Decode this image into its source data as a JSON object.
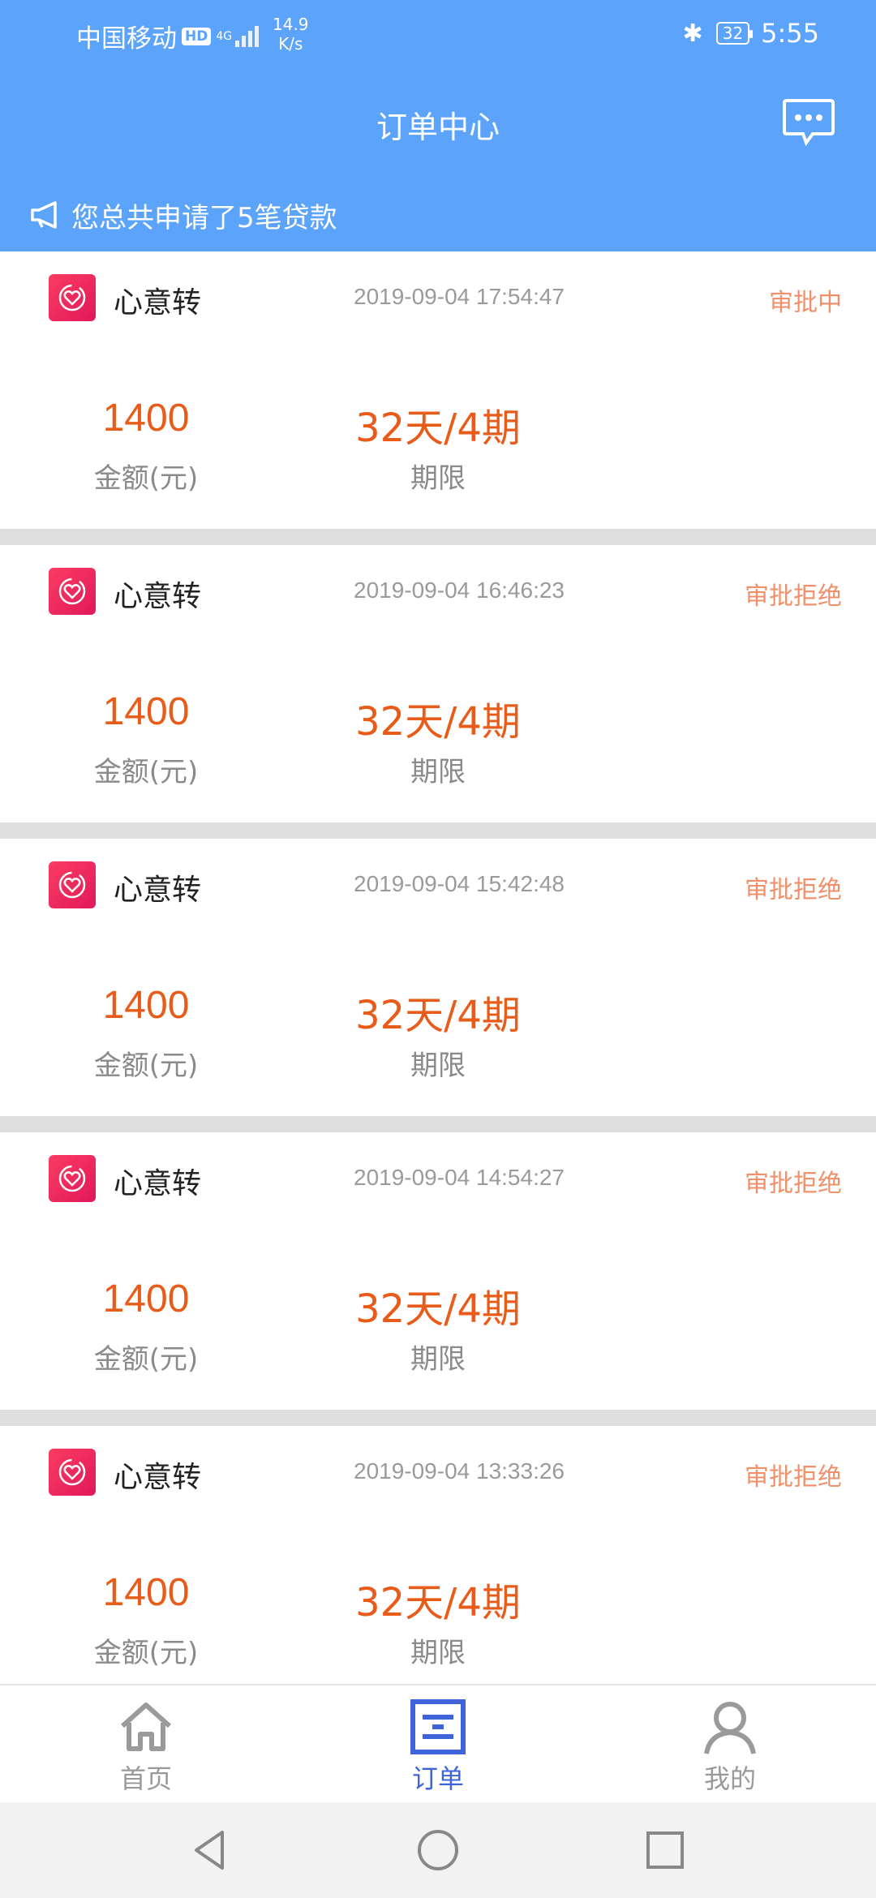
{
  "status_bar": {
    "carrier": "中国移动",
    "hd": "HD",
    "network": "4G",
    "speed_value": "14.9",
    "speed_unit": "K/s",
    "battery": "32",
    "time": "5:55"
  },
  "header": {
    "title": "订单中心"
  },
  "notice": {
    "text": "您总共申请了5笔贷款"
  },
  "orders": [
    {
      "product": "心意转",
      "time": "2019-09-04 17:54:47",
      "status": "审批中",
      "amount": "1400",
      "amount_label": "金额(元)",
      "term": "32天/4期",
      "term_label": "期限"
    },
    {
      "product": "心意转",
      "time": "2019-09-04 16:46:23",
      "status": "审批拒绝",
      "amount": "1400",
      "amount_label": "金额(元)",
      "term": "32天/4期",
      "term_label": "期限"
    },
    {
      "product": "心意转",
      "time": "2019-09-04 15:42:48",
      "status": "审批拒绝",
      "amount": "1400",
      "amount_label": "金额(元)",
      "term": "32天/4期",
      "term_label": "期限"
    },
    {
      "product": "心意转",
      "time": "2019-09-04 14:54:27",
      "status": "审批拒绝",
      "amount": "1400",
      "amount_label": "金额(元)",
      "term": "32天/4期",
      "term_label": "期限"
    },
    {
      "product": "心意转",
      "time": "2019-09-04 13:33:26",
      "status": "审批拒绝",
      "amount": "1400",
      "amount_label": "金额(元)",
      "term": "32天/4期",
      "term_label": "期限"
    }
  ],
  "tabs": [
    {
      "label": "首页",
      "icon": "home-icon"
    },
    {
      "label": "订单",
      "icon": "order-icon",
      "active": true
    },
    {
      "label": "我的",
      "icon": "profile-icon"
    }
  ],
  "colors": {
    "brand_blue": "#5ba3fb",
    "amount_orange": "#e85b18",
    "status_orange": "#f0906a",
    "tab_active": "#3f63d9"
  }
}
